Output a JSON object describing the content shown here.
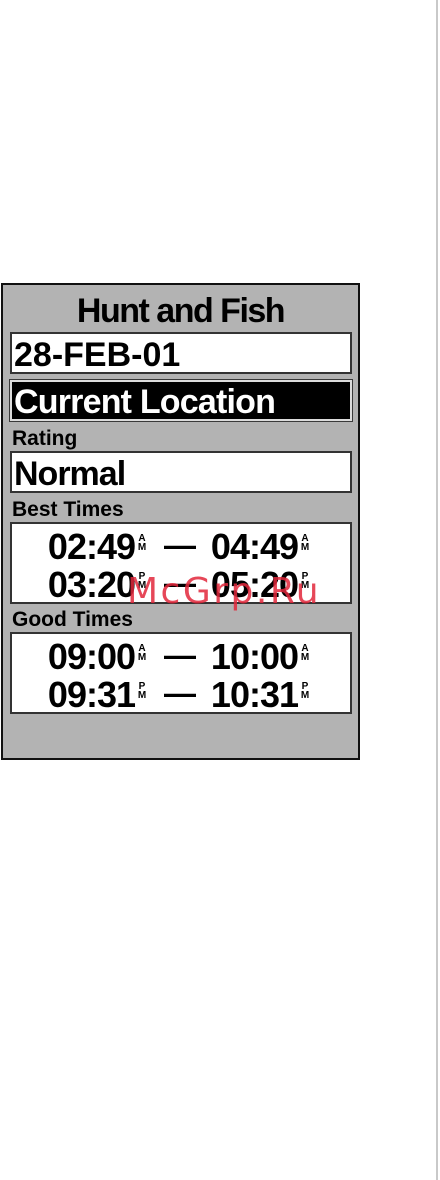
{
  "screen": {
    "title": "Hunt and Fish",
    "date": "28-FEB-01",
    "location": "Current Location",
    "rating": {
      "label": "Rating",
      "value": "Normal"
    },
    "best_times": {
      "label": "Best Times",
      "rows": [
        {
          "start": "02:49",
          "start_meridiem": "AM",
          "end": "04:49",
          "end_meridiem": "AM"
        },
        {
          "start": "03:20",
          "start_meridiem": "PM",
          "end": "05:20",
          "end_meridiem": "PM"
        }
      ]
    },
    "good_times": {
      "label": "Good Times",
      "rows": [
        {
          "start": "09:00",
          "start_meridiem": "AM",
          "end": "10:00",
          "end_meridiem": "AM"
        },
        {
          "start": "09:31",
          "start_meridiem": "PM",
          "end": "10:31",
          "end_meridiem": "PM"
        }
      ]
    },
    "time_separator": "—"
  },
  "watermark": "McGrp.Ru",
  "colors": {
    "screen_background": "#b3b3b3",
    "field_background": "#ffffff",
    "field_border": "#333333",
    "highlight_background": "#000000",
    "highlight_text": "#ffffff",
    "text": "#000000",
    "watermark": "#e2283c",
    "page_rule": "#c9c9c9"
  }
}
